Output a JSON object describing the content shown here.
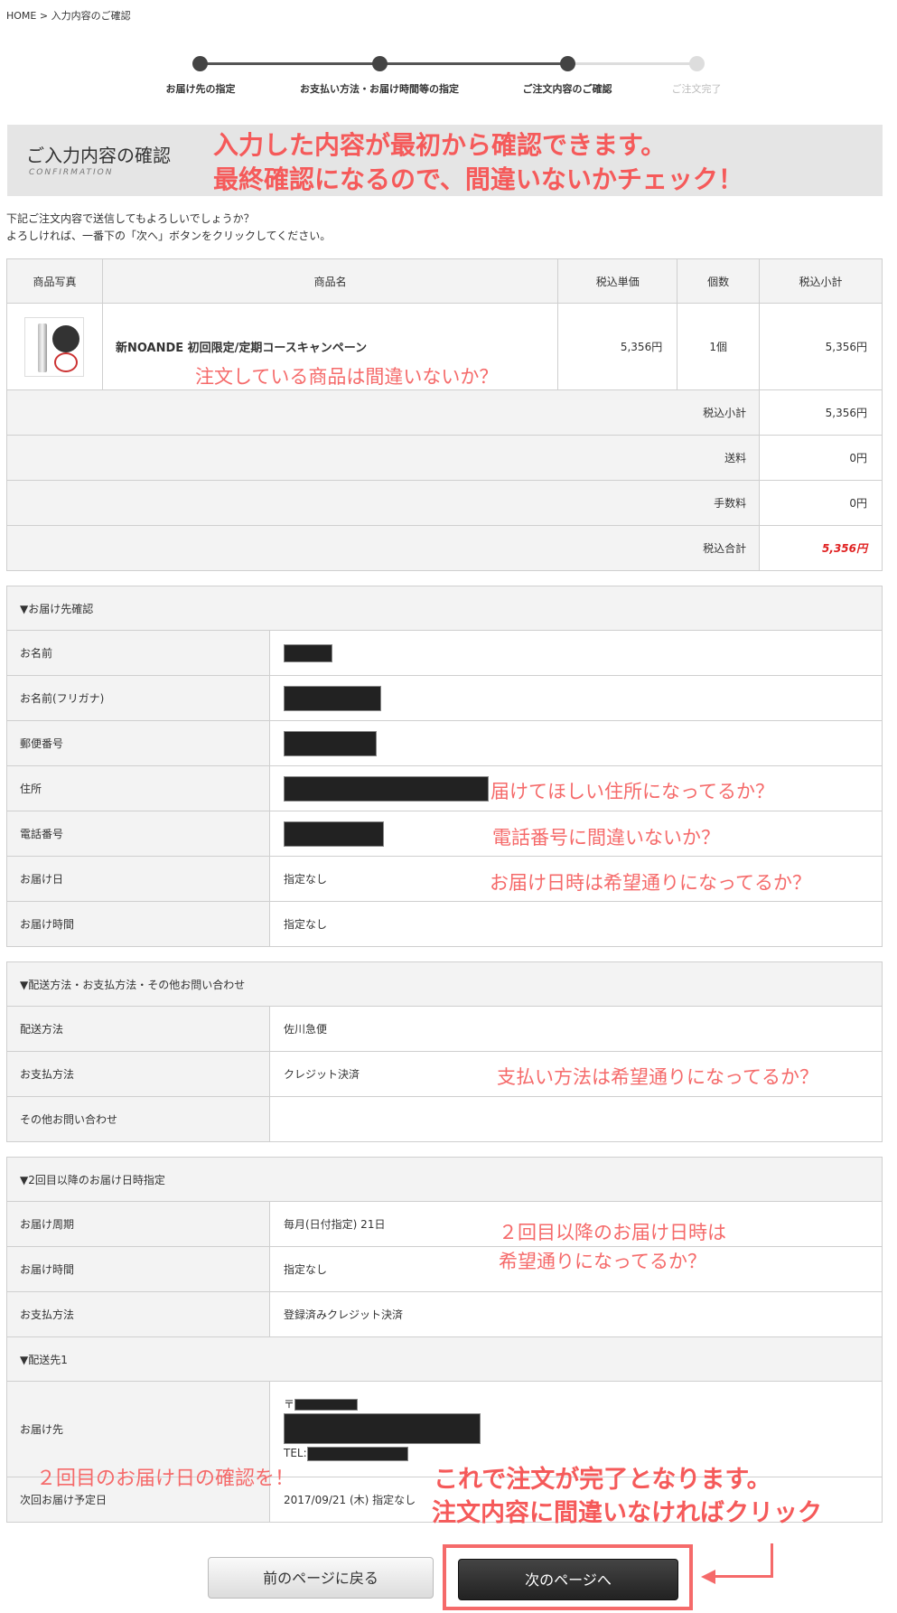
{
  "breadcrumb": {
    "home": "HOME",
    "separator": ">",
    "current": "入力内容のご確認"
  },
  "steps": [
    {
      "label": "お届け先の指定",
      "state": "done"
    },
    {
      "label": "お支払い方法・お届け時間等の指定",
      "state": "done"
    },
    {
      "label": "ご注文内容のご確認",
      "state": "done"
    },
    {
      "label": "ご注文完了",
      "state": "todo"
    }
  ],
  "title": {
    "jp": "ご入力内容の確認",
    "en": "CONFIRMATION"
  },
  "annotations": {
    "headline1": "入力した内容が最初から確認できます。",
    "headline2": "最終確認になるので、間違いないかチェック！",
    "product": "注文している商品は間違いないか？",
    "address": "届けてほしい住所になってるか？",
    "phone": "電話番号に間違いないか？",
    "delivery_date": "お届け日時は希望通りになってるか？",
    "payment": "支払い方法は希望通りになってるか？",
    "second_delivery1": "２回目以降のお届け日時は",
    "second_delivery2": "希望通りになってるか？",
    "second_date": "２回目のお届け日の確認を！",
    "complete1": "これで注文が完了となります。",
    "complete2": "注文内容に間違いなければクリック"
  },
  "intro": {
    "line1": "下記ご注文内容で送信してもよろしいでしょうか？",
    "line2": "よろしければ、一番下の「次へ」ボタンをクリックしてください。"
  },
  "items_table": {
    "headers": [
      "商品写真",
      "商品名",
      "税込単価",
      "個数",
      "税込小計"
    ],
    "rows": [
      {
        "name": "新NOANDE 初回限定/定期コースキャンペーン",
        "price": "5,356円",
        "qty": "1個",
        "subtotal": "5,356円"
      }
    ],
    "summary": [
      {
        "label": "税込小計",
        "value": "5,356円"
      },
      {
        "label": "送料",
        "value": "0円"
      },
      {
        "label": "手数料",
        "value": "0円"
      },
      {
        "label": "税込合計",
        "value": "5,356円"
      }
    ]
  },
  "delivery": {
    "heading": "▼お届け先確認",
    "rows": [
      {
        "label": "お名前",
        "value": ""
      },
      {
        "label": "お名前(フリガナ)",
        "value": ""
      },
      {
        "label": "郵便番号",
        "value": ""
      },
      {
        "label": "住所",
        "value": ""
      },
      {
        "label": "電話番号",
        "value": ""
      },
      {
        "label": "お届け日",
        "value": "指定なし"
      },
      {
        "label": "お届け時間",
        "value": "指定なし"
      }
    ]
  },
  "shipping": {
    "heading": "▼配送方法・お支払方法・その他お問い合わせ",
    "rows": [
      {
        "label": "配送方法",
        "value": "佐川急便"
      },
      {
        "label": "お支払方法",
        "value": "クレジット決済"
      },
      {
        "label": "その他お問い合わせ",
        "value": ""
      }
    ]
  },
  "subsequent": {
    "heading": "▼2回目以降のお届け日時指定",
    "rows": [
      {
        "label": "お届け周期",
        "value": "毎月(日付指定) 21日"
      },
      {
        "label": "お届け時間",
        "value": "指定なし"
      },
      {
        "label": "お支払方法",
        "value": "登録済みクレジット決済"
      }
    ],
    "dest_heading": "▼配送先1",
    "dest_label": "お届け先",
    "postal_mark": "〒",
    "tel_label": "TEL:",
    "next_label": "次回お届け予定日",
    "next_value": "2017/09/21 (木) 指定なし"
  },
  "buttons": {
    "back": "前のページに戻る",
    "next": "次のページへ"
  },
  "colors": {
    "annotation": "#f56a6a",
    "total": "#e02020",
    "step_done": "#444444",
    "step_todo": "#dddddd"
  }
}
